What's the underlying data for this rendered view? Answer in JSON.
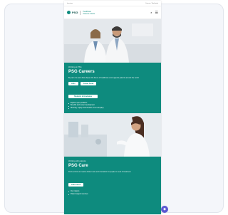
{
  "utility": {
    "left": "Investors",
    "right": "Contact  •  Worldwide"
  },
  "brand": {
    "name": "PSG",
    "sub_line1": "Healthcare",
    "sub_line2": "Careers & Jobs"
  },
  "section1": {
    "eyebrow": "Working at PSG",
    "title": "PSG Careers",
    "desc": "Be part of a team that shapes the future of healthcare and supports patients around the world.",
    "buttons": [
      "Jobs",
      "Career Areas"
    ],
    "wide_button": "Students & Graduates",
    "bullets": [
      "Explore open positions",
      "Benefits and career development",
      "Diversity, equity and inclusion at our company"
    ]
  },
  "section2": {
    "eyebrow": "Working with patients",
    "title": "PSG Care",
    "desc": "Find out how our teams deliver care and innovation for people in need of treatment.",
    "button": "Learn more",
    "bullets": [
      "Our mission",
      "Patient support services"
    ]
  },
  "colors": {
    "teal": "#0e8b7e",
    "fab": "#5b57d1"
  },
  "icons": {
    "menu": "☰",
    "search": "⌕",
    "fab": "◆"
  }
}
